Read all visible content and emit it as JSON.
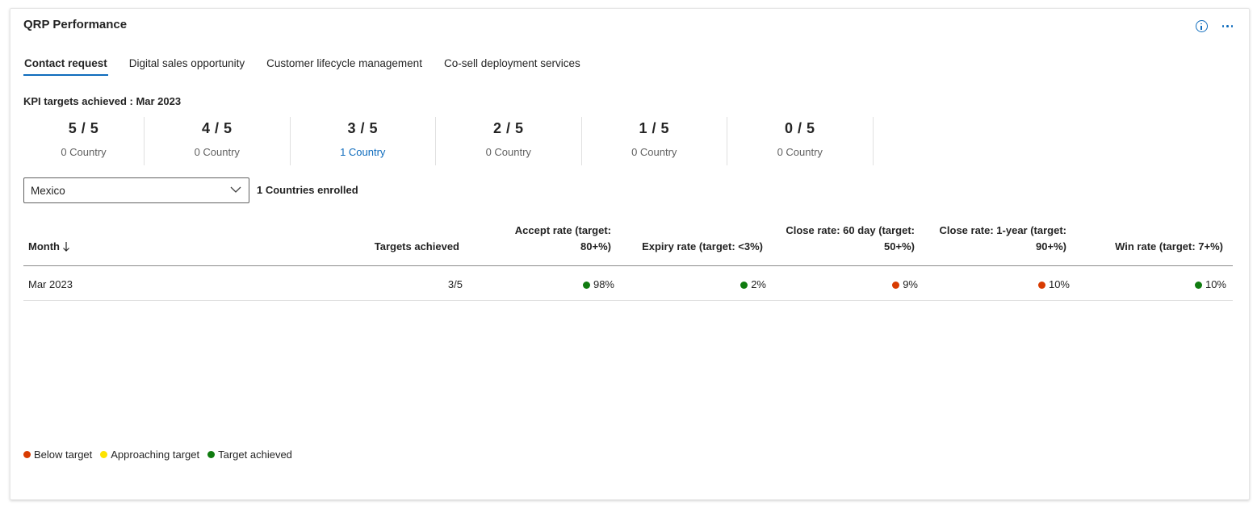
{
  "header": {
    "title": "QRP Performance",
    "info_icon": "info-icon",
    "more_icon": "more-options-icon"
  },
  "tabs": [
    {
      "label": "Contact request",
      "active": true
    },
    {
      "label": "Digital sales opportunity",
      "active": false
    },
    {
      "label": "Customer lifecycle management",
      "active": false
    },
    {
      "label": "Co-sell deployment services",
      "active": false
    }
  ],
  "kpi": {
    "title": "KPI targets achieved : Mar 2023",
    "items": [
      {
        "value": "5 / 5",
        "sub": "0 Country"
      },
      {
        "value": "4 / 5",
        "sub": "0 Country"
      },
      {
        "value": "3 / 5",
        "sub": "1 Country"
      },
      {
        "value": "2 / 5",
        "sub": "0 Country"
      },
      {
        "value": "1 / 5",
        "sub": "0 Country"
      },
      {
        "value": "0 / 5",
        "sub": "0 Country"
      }
    ]
  },
  "filter": {
    "selected": "Mexico",
    "enrolled": "1 Countries enrolled"
  },
  "table": {
    "headers": {
      "month": "Month",
      "targets": "Targets achieved",
      "accept_1": "Accept rate (target:",
      "accept_2": "80+%)",
      "expiry": "Expiry rate (target: <3%)",
      "close60_1": "Close rate: 60 day (target:",
      "close60_2": "50+%)",
      "close1y_1": "Close rate: 1-year (target:",
      "close1y_2": "90+%)",
      "win": "Win rate (target: 7+%)"
    },
    "rows": [
      {
        "month": "Mar 2023",
        "targets": "3/5",
        "accept": "98%",
        "expiry": "2%",
        "close60": "9%",
        "close1y": "10%",
        "win": "10%"
      }
    ]
  },
  "legend": {
    "below": "Below target",
    "approaching": "Approaching target",
    "achieved": "Target achieved"
  },
  "colors": {
    "accent": "#0f6cbd",
    "below": "#d83b01",
    "approaching": "#fde300",
    "achieved": "#107c10"
  }
}
